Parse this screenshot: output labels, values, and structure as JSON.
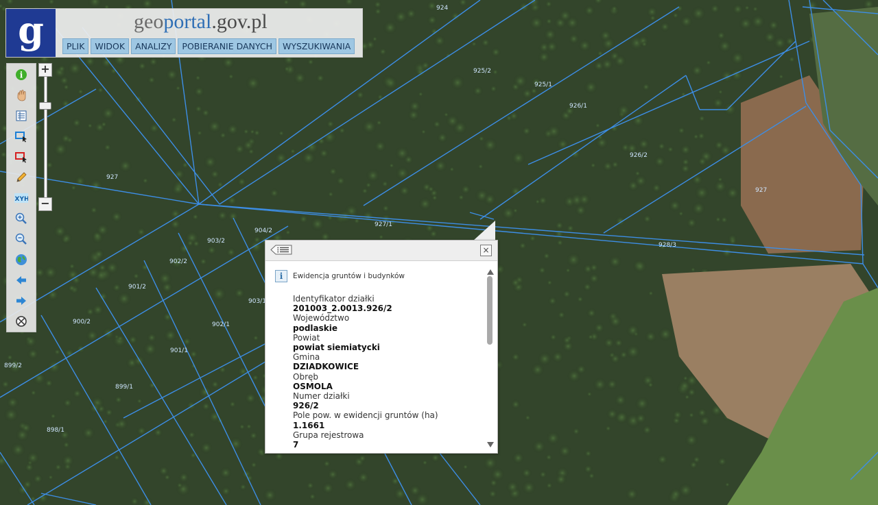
{
  "header": {
    "logo_letter": "g",
    "site_title": {
      "geo": "geo",
      "portal": "portal",
      "domain": ".gov.pl"
    },
    "menu": [
      "PLIK",
      "WIDOK",
      "ANALIZY",
      "POBIERANIE DANYCH",
      "WYSZUKIWANIA"
    ]
  },
  "toolbar": {
    "tools": [
      "info-icon",
      "hand-pan-icon",
      "legend-table-icon",
      "select-blue-icon",
      "select-red-icon",
      "pencil-icon",
      "xyh-icon",
      "zoom-in-icon",
      "zoom-out-icon",
      "globe-icon",
      "back-arrow-icon",
      "forward-arrow-icon",
      "clear-circle-icon"
    ],
    "xyh_label": "XYH"
  },
  "zoom": {
    "plus": "+",
    "minus": "−"
  },
  "map": {
    "parcel_labels": [
      "924",
      "925/2",
      "925/1",
      "926/1",
      "926/2",
      "927",
      "927",
      "927/1",
      "928/3",
      "904/2",
      "903/2",
      "902/2",
      "903/1",
      "901/2",
      "902/1",
      "900/2",
      "901/1",
      "899/2",
      "899/1",
      "898/1"
    ],
    "colors": {
      "parcel_line": "#3d8ee6",
      "label": "#cfe6ff"
    }
  },
  "popup": {
    "layer_name": "Ewidencja gruntów i budynków",
    "close_glyph": "×",
    "attributes": [
      {
        "label": "Identyfikator działki",
        "value": "201003_2.0013.926/2"
      },
      {
        "label": "Województwo",
        "value": "podlaskie"
      },
      {
        "label": "Powiat",
        "value": "powiat siemiatycki"
      },
      {
        "label": "Gmina",
        "value": "DZIADKOWICE"
      },
      {
        "label": "Obręb",
        "value": "OSMOLA"
      },
      {
        "label": "Numer działki",
        "value": "926/2"
      },
      {
        "label": "Pole pow. w ewidencji gruntów (ha)",
        "value": "1.1661"
      },
      {
        "label": "Grupa rejestrowa",
        "value": "7"
      }
    ]
  }
}
